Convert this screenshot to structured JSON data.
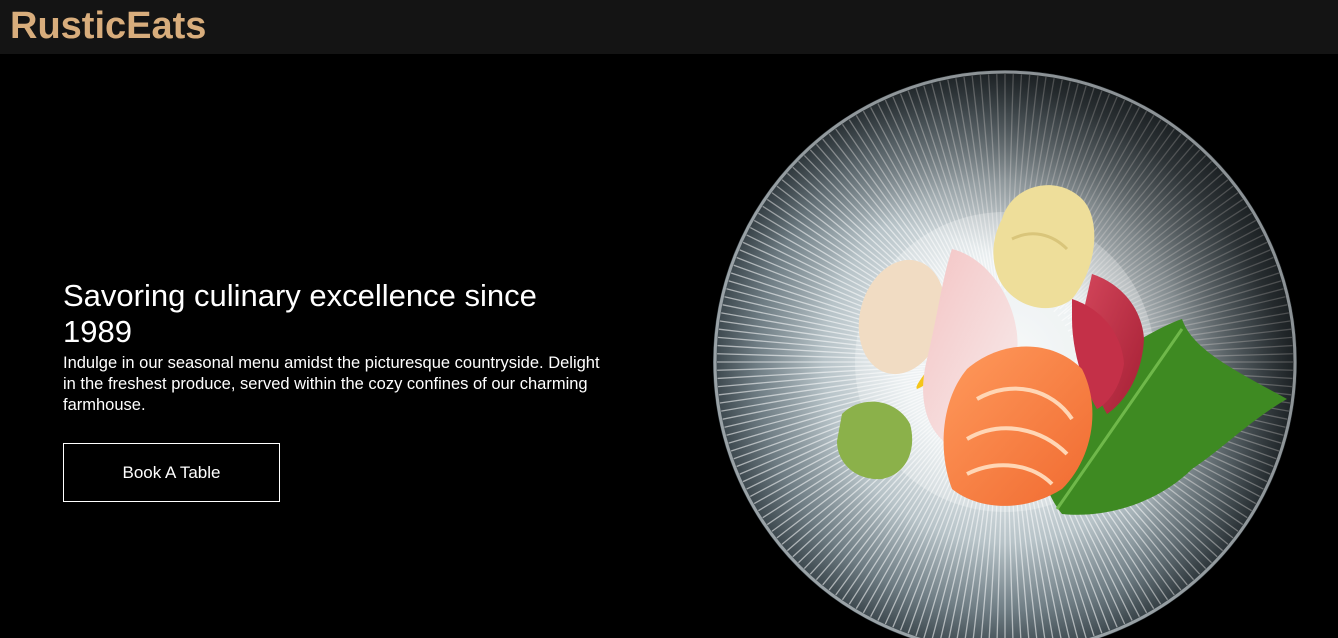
{
  "header": {
    "brand": "RusticEats",
    "brand_color": "#d8ad7c"
  },
  "hero": {
    "headline": "Savoring culinary excellence since 1989",
    "description": "Indulge in our seasonal menu amidst the picturesque countryside. Delight in the freshest produce, served within the cozy confines of our charming farmhouse.",
    "cta_label": "Book A Table"
  }
}
